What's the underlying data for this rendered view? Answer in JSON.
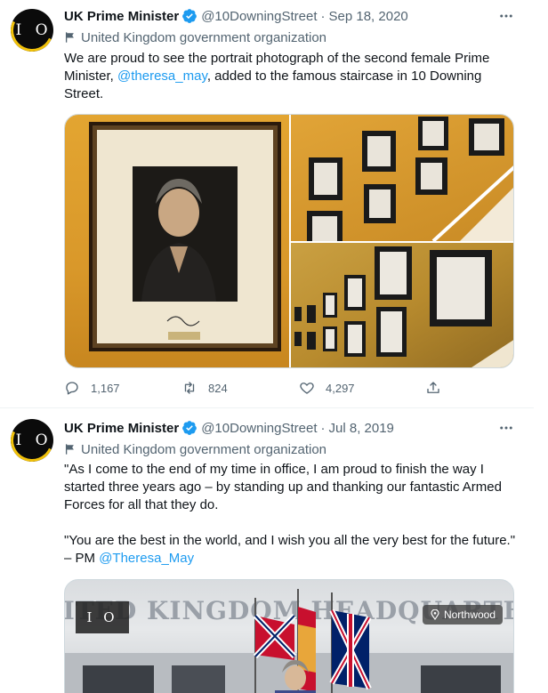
{
  "tweets": [
    {
      "avatar_text": "I O",
      "name": "UK Prime Minister",
      "handle": "@10DowningStreet",
      "dot": "·",
      "date": "Sep 18, 2020",
      "org_label": "United Kingdom government organization",
      "text_before": "We are proud to see the portrait photograph of the second female Prime Minister, ",
      "mention": "@theresa_may",
      "text_after": ", added to the famous staircase in 10 Downing Street.",
      "replies": "1,167",
      "retweets": "824",
      "likes": "4,297"
    },
    {
      "avatar_text": "I O",
      "name": "UK Prime Minister",
      "handle": "@10DowningStreet",
      "dot": "·",
      "date": "Jul 8, 2019",
      "org_label": "United Kingdom government organization",
      "paragraph1": "\"As I come to the end of my time in office, I am proud to finish the way I started three years ago – by standing up and thanking our fantastic Armed Forces for all that they do.",
      "paragraph2_before": "\"You are the best in the world, and I wish you all the very best for the future.\" – PM ",
      "mention": "@Theresa_May",
      "video": {
        "banner_text": "UNITED KINGDOM HEADQUARTERS",
        "logo_text": "I O",
        "location": "Northwood"
      }
    }
  ],
  "colors": {
    "accent": "#1d9bf0",
    "muted": "#536471",
    "text": "#0f1419",
    "avatar_ring": "#f2c20a"
  },
  "icons": [
    "verified-badge-icon",
    "more-icon",
    "flag-icon",
    "reply-icon",
    "retweet-icon",
    "like-icon",
    "share-icon",
    "location-pin-icon"
  ]
}
